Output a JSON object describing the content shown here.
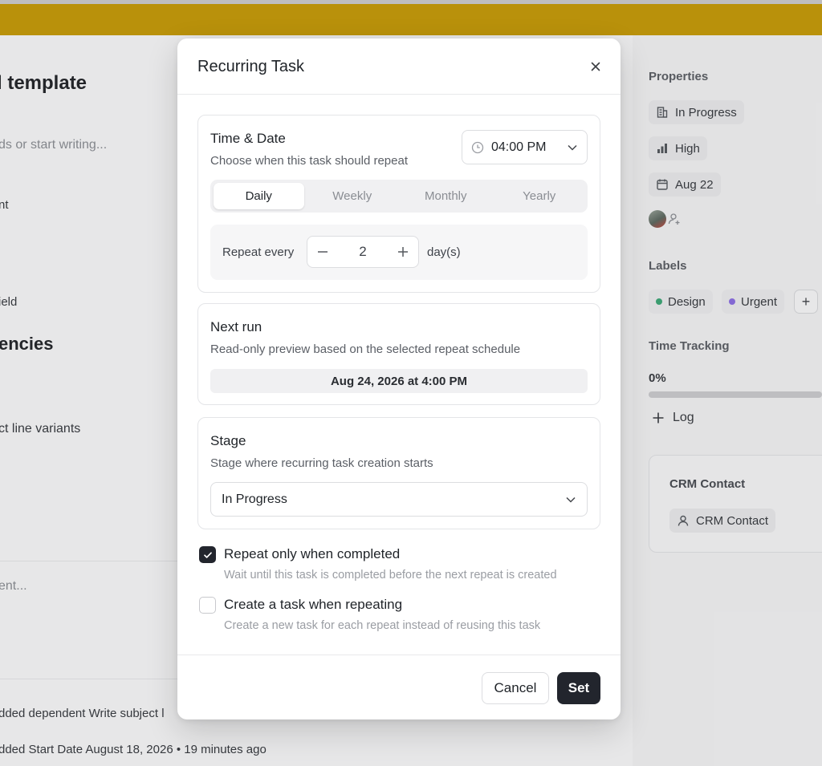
{
  "background": {
    "title": "l template",
    "placeholder": "ds or start writing...",
    "line_nt": "nt",
    "line_field": "ield",
    "dependencies_heading": "encies",
    "variants_line": "ct line variants",
    "comment_placeholder": "ent...",
    "activity": [
      "dded dependent Write subject l",
      "dded Start Date August 18, 2026 • 19 minutes ago"
    ],
    "banner_color": "#c49a0c"
  },
  "sidebar": {
    "properties_heading": "Properties",
    "status": "In Progress",
    "priority": "High",
    "due_date": "Aug 22",
    "labels_heading": "Labels",
    "labels": [
      {
        "name": "Design",
        "color": "#3fa677"
      },
      {
        "name": "Urgent",
        "color": "#8b6fe0"
      }
    ],
    "add_label_glyph": "+",
    "time_tracking_heading": "Time Tracking",
    "progress_text": "0%",
    "progress_value": 0,
    "log_label": "Log",
    "crm": {
      "heading": "CRM Contact",
      "button_label": "CRM Contact"
    }
  },
  "modal": {
    "title": "Recurring Task",
    "time_date": {
      "title": "Time & Date",
      "subtitle": "Choose when this task should repeat",
      "time_value": "04:00 PM",
      "tabs": [
        "Daily",
        "Weekly",
        "Monthly",
        "Yearly"
      ],
      "active_tab": "Daily",
      "repeat_label": "Repeat every",
      "repeat_value": "2",
      "repeat_unit": "day(s)"
    },
    "next_run": {
      "title": "Next run",
      "subtitle": "Read-only preview based on the selected repeat schedule",
      "value": "Aug 24, 2026 at 4:00 PM"
    },
    "stage": {
      "title": "Stage",
      "subtitle": "Stage where recurring task creation starts",
      "value": "In Progress"
    },
    "options": [
      {
        "label": "Repeat only when completed",
        "help": "Wait until this task is completed before the next repeat is created",
        "checked": true
      },
      {
        "label": "Create a task when repeating",
        "help": "Create a new task for each repeat instead of reusing this task",
        "checked": false
      }
    ],
    "cancel_label": "Cancel",
    "set_label": "Set"
  },
  "icons": {
    "close": "close-icon",
    "clock": "clock-icon",
    "chevron": "chevron-down-icon",
    "minus": "minus-icon",
    "plus": "plus-icon",
    "check": "check-icon"
  },
  "colors": {
    "primary_button": "#22252d",
    "overlay_banner": "#c49a0c"
  }
}
